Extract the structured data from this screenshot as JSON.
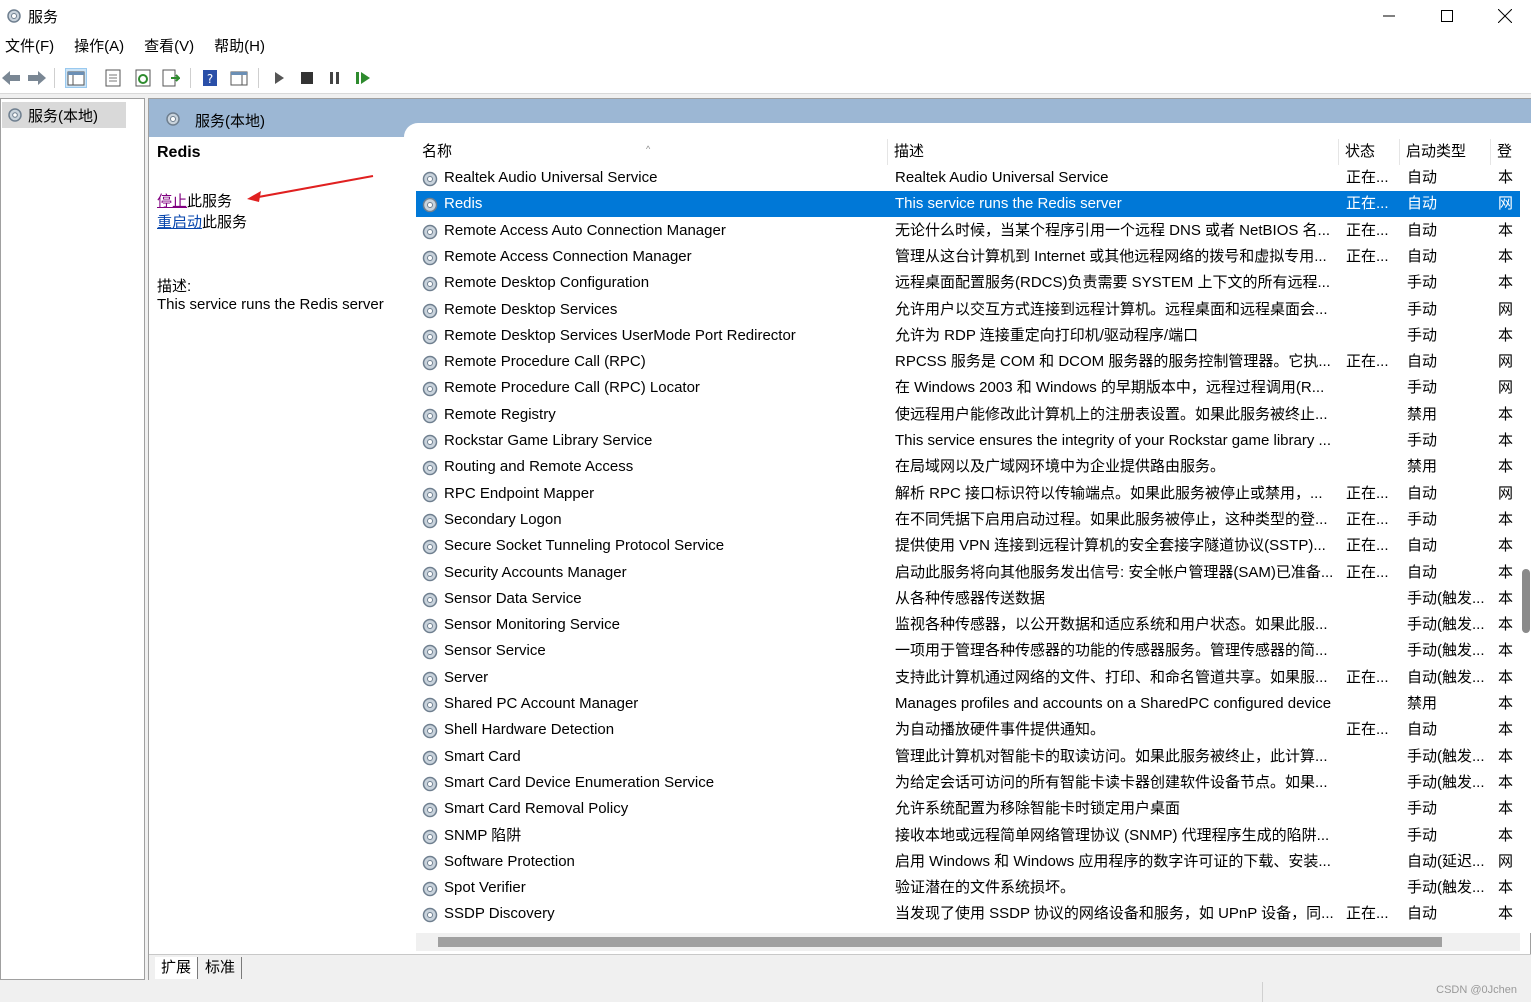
{
  "window": {
    "title": "服务"
  },
  "menu": [
    "文件(F)",
    "操作(A)",
    "查看(V)",
    "帮助(H)"
  ],
  "tree": {
    "root_label": "服务(本地)"
  },
  "pane": {
    "header_title": "服务(本地)"
  },
  "detail": {
    "service_name": "Redis",
    "stop_link": "停止",
    "stop_suffix": "此服务",
    "restart_link": "重启动",
    "restart_suffix": "此服务",
    "desc_label": "描述:",
    "desc_text": "This service runs the Redis server"
  },
  "columns": {
    "name": "名称",
    "desc": "描述",
    "status": "状态",
    "start": "启动类型",
    "login": "登"
  },
  "services": [
    {
      "name": "Realtek Audio Universal Service",
      "desc": "Realtek Audio Universal Service",
      "status": "正在...",
      "start": "自动",
      "login": "本"
    },
    {
      "name": "Redis",
      "desc": "This service runs the Redis server",
      "status": "正在...",
      "start": "自动",
      "login": "网"
    },
    {
      "name": "Remote Access Auto Connection Manager",
      "desc": "无论什么时候，当某个程序引用一个远程 DNS 或者 NetBIOS 名...",
      "status": "正在...",
      "start": "自动",
      "login": "本"
    },
    {
      "name": "Remote Access Connection Manager",
      "desc": "管理从这台计算机到 Internet 或其他远程网络的拨号和虚拟专用...",
      "status": "正在...",
      "start": "自动",
      "login": "本"
    },
    {
      "name": "Remote Desktop Configuration",
      "desc": "远程桌面配置服务(RDCS)负责需要 SYSTEM 上下文的所有远程...",
      "status": "",
      "start": "手动",
      "login": "本"
    },
    {
      "name": "Remote Desktop Services",
      "desc": "允许用户以交互方式连接到远程计算机。远程桌面和远程桌面会...",
      "status": "",
      "start": "手动",
      "login": "网"
    },
    {
      "name": "Remote Desktop Services UserMode Port Redirector",
      "desc": "允许为 RDP 连接重定向打印机/驱动程序/端口",
      "status": "",
      "start": "手动",
      "login": "本"
    },
    {
      "name": "Remote Procedure Call (RPC)",
      "desc": "RPCSS 服务是 COM 和 DCOM 服务器的服务控制管理器。它执...",
      "status": "正在...",
      "start": "自动",
      "login": "网"
    },
    {
      "name": "Remote Procedure Call (RPC) Locator",
      "desc": "在 Windows 2003 和 Windows 的早期版本中，远程过程调用(R...",
      "status": "",
      "start": "手动",
      "login": "网"
    },
    {
      "name": "Remote Registry",
      "desc": "使远程用户能修改此计算机上的注册表设置。如果此服务被终止...",
      "status": "",
      "start": "禁用",
      "login": "本"
    },
    {
      "name": "Rockstar Game Library Service",
      "desc": "This service ensures the integrity of your Rockstar game library ...",
      "status": "",
      "start": "手动",
      "login": "本"
    },
    {
      "name": "Routing and Remote Access",
      "desc": "在局域网以及广域网环境中为企业提供路由服务。",
      "status": "",
      "start": "禁用",
      "login": "本"
    },
    {
      "name": "RPC Endpoint Mapper",
      "desc": "解析 RPC 接口标识符以传输端点。如果此服务被停止或禁用，...",
      "status": "正在...",
      "start": "自动",
      "login": "网"
    },
    {
      "name": "Secondary Logon",
      "desc": "在不同凭据下启用启动过程。如果此服务被停止，这种类型的登...",
      "status": "正在...",
      "start": "手动",
      "login": "本"
    },
    {
      "name": "Secure Socket Tunneling Protocol Service",
      "desc": "提供使用 VPN 连接到远程计算机的安全套接字隧道协议(SSTP)...",
      "status": "正在...",
      "start": "自动",
      "login": "本"
    },
    {
      "name": "Security Accounts Manager",
      "desc": "启动此服务将向其他服务发出信号: 安全帐户管理器(SAM)已准备...",
      "status": "正在...",
      "start": "自动",
      "login": "本"
    },
    {
      "name": "Sensor Data Service",
      "desc": "从各种传感器传送数据",
      "status": "",
      "start": "手动(触发...",
      "login": "本"
    },
    {
      "name": "Sensor Monitoring Service",
      "desc": "监视各种传感器，以公开数据和适应系统和用户状态。如果此服...",
      "status": "",
      "start": "手动(触发...",
      "login": "本"
    },
    {
      "name": "Sensor Service",
      "desc": "一项用于管理各种传感器的功能的传感器服务。管理传感器的简...",
      "status": "",
      "start": "手动(触发...",
      "login": "本"
    },
    {
      "name": "Server",
      "desc": "支持此计算机通过网络的文件、打印、和命名管道共享。如果服...",
      "status": "正在...",
      "start": "自动(触发...",
      "login": "本"
    },
    {
      "name": "Shared PC Account Manager",
      "desc": "Manages profiles and accounts on a SharedPC configured device",
      "status": "",
      "start": "禁用",
      "login": "本"
    },
    {
      "name": "Shell Hardware Detection",
      "desc": "为自动播放硬件事件提供通知。",
      "status": "正在...",
      "start": "自动",
      "login": "本"
    },
    {
      "name": "Smart Card",
      "desc": "管理此计算机对智能卡的取读访问。如果此服务被终止，此计算...",
      "status": "",
      "start": "手动(触发...",
      "login": "本"
    },
    {
      "name": "Smart Card Device Enumeration Service",
      "desc": "为给定会话可访问的所有智能卡读卡器创建软件设备节点。如果...",
      "status": "",
      "start": "手动(触发...",
      "login": "本"
    },
    {
      "name": "Smart Card Removal Policy",
      "desc": "允许系统配置为移除智能卡时锁定用户桌面",
      "status": "",
      "start": "手动",
      "login": "本"
    },
    {
      "name": "SNMP 陷阱",
      "desc": "接收本地或远程简单网络管理协议 (SNMP) 代理程序生成的陷阱...",
      "status": "",
      "start": "手动",
      "login": "本"
    },
    {
      "name": "Software Protection",
      "desc": "启用 Windows 和 Windows 应用程序的数字许可证的下载、安装...",
      "status": "",
      "start": "自动(延迟...",
      "login": "网"
    },
    {
      "name": "Spot Verifier",
      "desc": "验证潜在的文件系统损坏。",
      "status": "",
      "start": "手动(触发...",
      "login": "本"
    },
    {
      "name": "SSDP Discovery",
      "desc": "当发现了使用 SSDP 协议的网络设备和服务，如 UPnP 设备，同...",
      "status": "正在...",
      "start": "自动",
      "login": "本"
    }
  ],
  "selected_index": 1,
  "tabs": [
    "扩展",
    "标准"
  ],
  "watermark": "CSDN @0Jchen",
  "colors": {
    "selection": "#0078d7",
    "header": "#9cb7d4",
    "link": "#0645ad"
  }
}
